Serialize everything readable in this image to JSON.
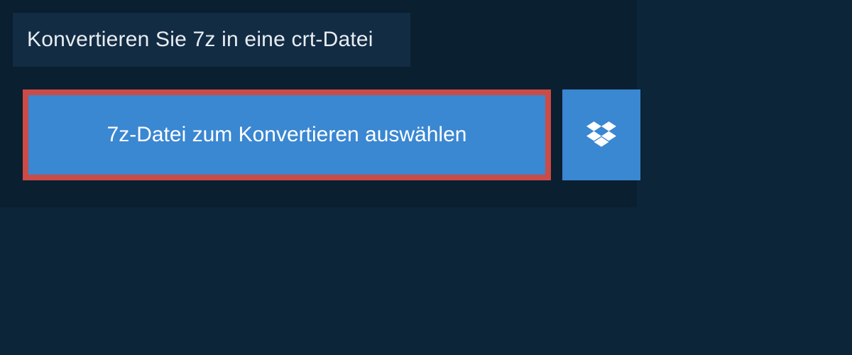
{
  "title": "Konvertieren Sie 7z in eine crt-Datei",
  "select_button_label": "7z-Datei zum Konvertieren auswählen",
  "colors": {
    "page_bg": "#0c2539",
    "band_bg": "#0a1f2f",
    "tab_bg": "#122c44",
    "button_bg": "#3a87d2",
    "highlight_border": "#cb4b47"
  }
}
